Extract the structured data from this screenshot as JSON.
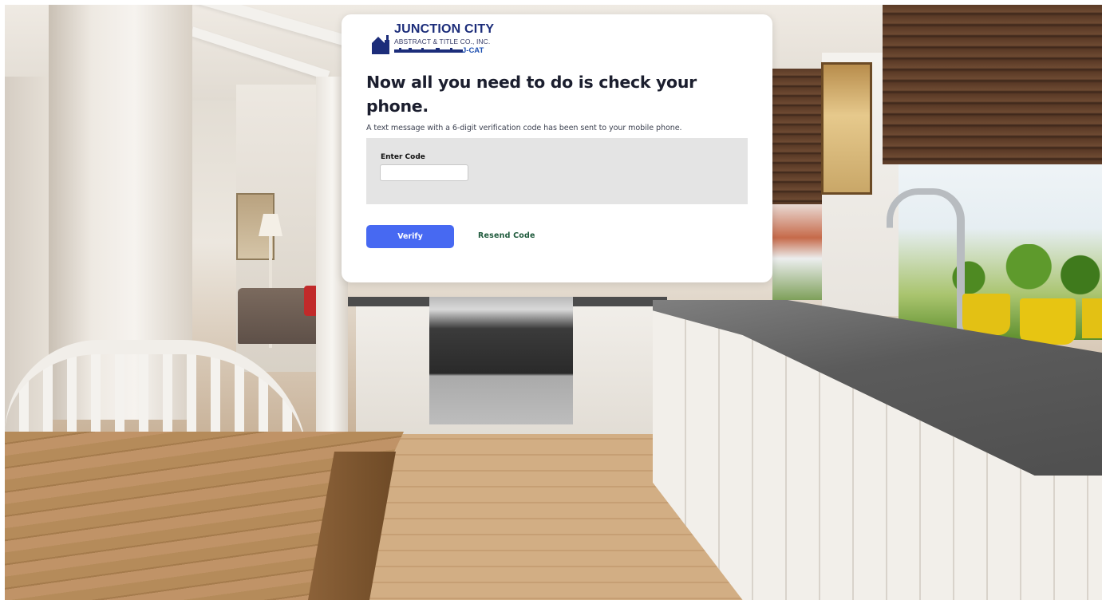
{
  "brand": {
    "logo_main": "JUNCTION CITY",
    "logo_sub": "ABSTRACT & TITLE CO., INC.",
    "logo_tag": "J-CAT",
    "primary_color": "#1c2d7a",
    "accent_color": "#4769f2"
  },
  "verification": {
    "heading": "Now all you need to do is check your phone.",
    "message": "A text message with a 6-digit verification code has been sent to your mobile phone.",
    "code_label": "Enter Code",
    "code_value": "",
    "verify_label": "Verify",
    "resend_label": "Resend Code"
  },
  "background": {
    "scene": "kitchen-photo"
  }
}
